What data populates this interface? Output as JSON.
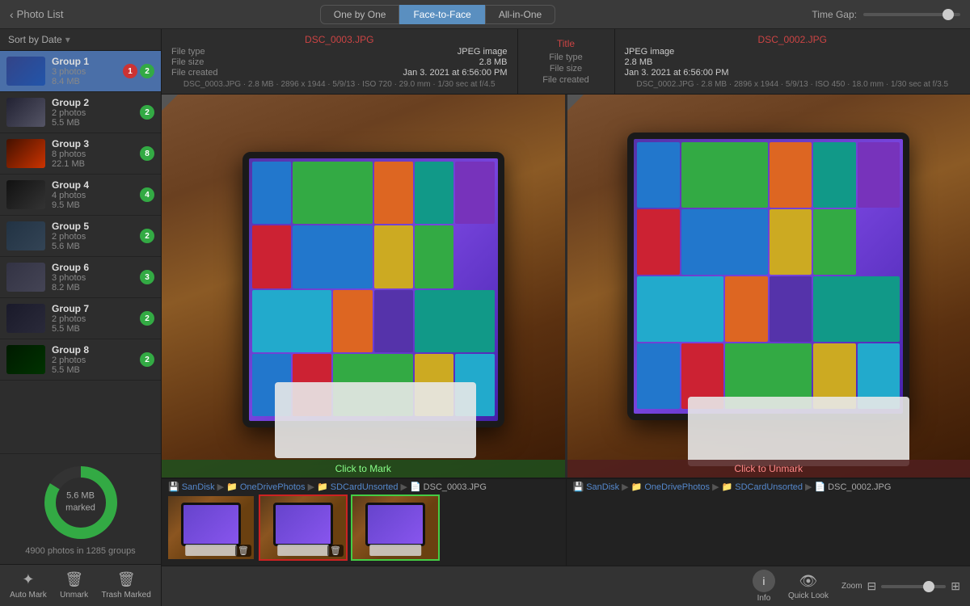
{
  "topbar": {
    "back_label": "Photo List",
    "tabs": [
      {
        "id": "one-by-one",
        "label": "One by One"
      },
      {
        "id": "face-to-face",
        "label": "Face-to-Face",
        "active": true
      },
      {
        "id": "all-in-one",
        "label": "All-in-One"
      }
    ],
    "time_gap_label": "Time Gap:"
  },
  "sidebar": {
    "sort_label": "Sort by Date",
    "groups": [
      {
        "name": "Group 1",
        "photos": "3 photos",
        "size": "8.4 MB",
        "badge1": "1",
        "badge2": "2",
        "badge1_color": "red",
        "badge2_color": "green",
        "selected": true,
        "thumb_style": "blue"
      },
      {
        "name": "Group 2",
        "photos": "2 photos",
        "size": "5.5 MB",
        "badge1": "2",
        "badge1_color": "green",
        "thumb_style": "laptop"
      },
      {
        "name": "Group 3",
        "photos": "8 photos",
        "size": "22.1 MB",
        "badge1": "8",
        "badge1_color": "green",
        "thumb_style": "dark"
      },
      {
        "name": "Group 4",
        "photos": "4 photos",
        "size": "9.5 MB",
        "badge1": "4",
        "badge1_color": "green",
        "thumb_style": "dark"
      },
      {
        "name": "Group 5",
        "photos": "2 photos",
        "size": "5.6 MB",
        "badge1": "2",
        "badge1_color": "green",
        "thumb_style": "laptop"
      },
      {
        "name": "Group 6",
        "photos": "3 photos",
        "size": "8.2 MB",
        "badge1": "3",
        "badge1_color": "green",
        "thumb_style": "laptop"
      },
      {
        "name": "Group 7",
        "photos": "2 photos",
        "size": "5.5 MB",
        "badge1": "2",
        "badge1_color": "green",
        "thumb_style": "dark"
      },
      {
        "name": "Group 8",
        "photos": "2 photos",
        "size": "5.5 MB",
        "badge1": "2",
        "badge1_color": "green",
        "thumb_style": "green"
      }
    ],
    "marked_size": "5.6 MB",
    "marked_label": "marked",
    "photos_count": "4900 photos in 1285 groups",
    "toolbar": {
      "auto_mark": "Auto Mark",
      "unmark": "Unmark",
      "trash_marked": "Trash Marked"
    }
  },
  "left_panel": {
    "filename": "DSC_0003.JPG",
    "title_label": "Title",
    "filetype_label": "File type",
    "filetype": "JPEG image",
    "filesize_label": "File size",
    "filesize": "2.8 MB",
    "created_label": "File created",
    "created": "Jan 3. 2021 at 6:56:00 PM",
    "exif": "DSC_0003.JPG  ·  2.8 MB  ·  2896 x 1944  ·  5/9/13  ·  ISO 720  ·  29.0 mm  ·  1/30 sec at f/4.5",
    "mark_label": "Click to Mark"
  },
  "right_panel": {
    "filename": "DSC_0002.JPG",
    "title_label": "Title",
    "filetype_label": "File type",
    "filetype": "JPEG image",
    "filesize_label": "File size",
    "filesize": "2.8 MB",
    "created_label": "File created",
    "created": "Jan 3. 2021 at 6:56:00 PM",
    "exif": "DSC_0002.JPG  ·  2.8 MB  ·  2896 x 1944  ·  5/9/13  ·  ISO 450  ·  18.0 mm  ·  1/30 sec at f/3.5",
    "mark_label": "Click to Unmark"
  },
  "strip_left": {
    "path": "SanDisk ▶ OneDrivePhotos ▶ SDCardUnsorted ▶ DSC_0003.JPG",
    "path_parts": [
      "SanDisk",
      "OneDrivePhotos",
      "SDCardUnsorted",
      "DSC_0003.JPG"
    ]
  },
  "strip_right": {
    "path": "SanDisk ▶ OneDrivePhotos ▶ SDCardUnsorted ▶ DSC_0002.JPG",
    "path_parts": [
      "SanDisk",
      "OneDrivePhotos",
      "SDCardUnsorted",
      "DSC_0002.JPG"
    ]
  },
  "bottom_tools": {
    "info_label": "Info",
    "quicklook_label": "Quick Look",
    "zoom_label": "Zoom"
  }
}
